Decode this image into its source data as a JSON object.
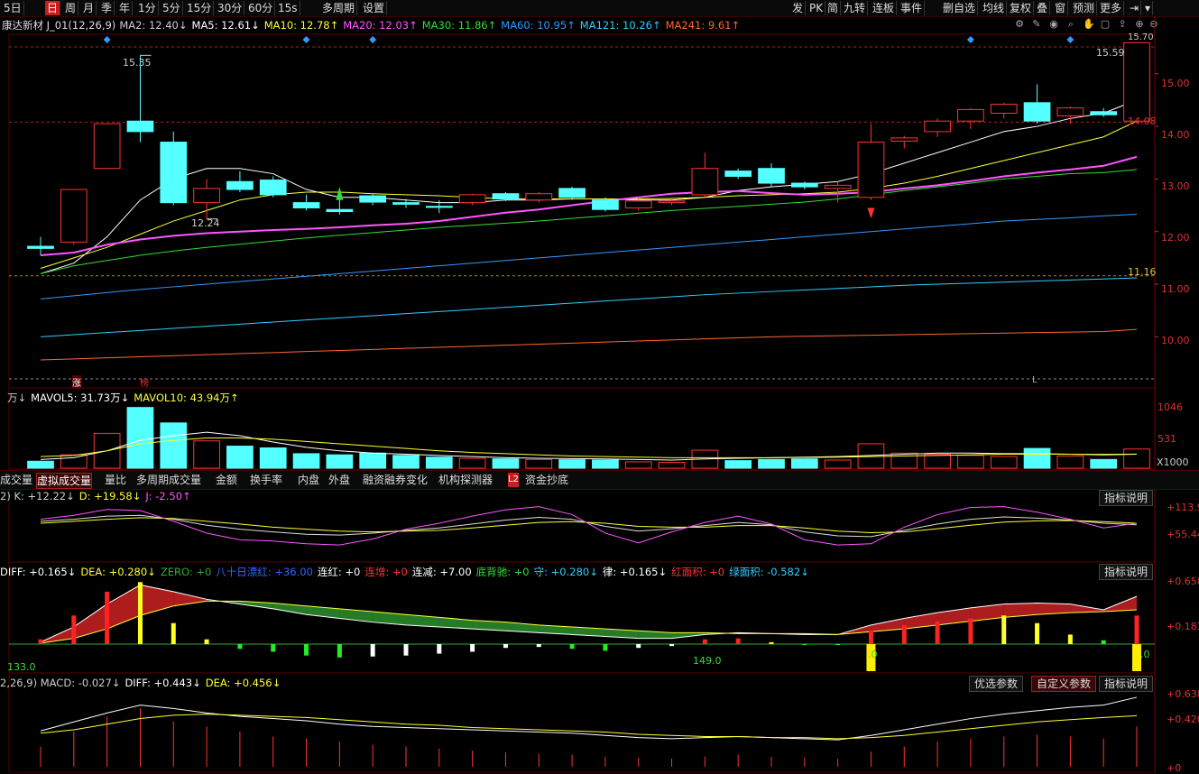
{
  "toolbar": {
    "left": [
      "5日",
      "日",
      "周",
      "月",
      "季",
      "年",
      "1分",
      "5分",
      "15分",
      "30分",
      "60分",
      "15s",
      "多周期",
      "设置"
    ],
    "active": "日",
    "right": [
      "发",
      "PK",
      "简",
      "九转",
      "连板",
      "事件",
      "删自选",
      "均线",
      "复权",
      "叠",
      "窗",
      "预测",
      "更多"
    ]
  },
  "header": {
    "name": "康达新材 J_01(12,26,9)",
    "ma": [
      {
        "label": "MA2: 12.40↓",
        "color": "#cccccc"
      },
      {
        "label": "MA5: 12.61↓",
        "color": "#ffffff"
      },
      {
        "label": "MA10: 12.78↑",
        "color": "#ffff33"
      },
      {
        "label": "MA20: 12.03↑",
        "color": "#ff55ff"
      },
      {
        "label": "MA30: 11.86↑",
        "color": "#33dd33"
      },
      {
        "label": "MA60: 10.95↑",
        "color": "#3399ff"
      },
      {
        "label": "MA121: 10.26↑",
        "color": "#33ccff"
      },
      {
        "label": "MA241: 9.61↑",
        "color": "#ff6633"
      }
    ]
  },
  "price_panel": {
    "ticks": [
      "15.00",
      "14.00",
      "13.00",
      "12.00",
      "11.00",
      "10.00"
    ],
    "labels": {
      "high": "15.35",
      "low": "12.24",
      "right_high": "15.59",
      "right_level": "14.08",
      "top_right": "15.70",
      "level2": "11.16"
    },
    "markers": [
      "涨",
      "榜",
      "L"
    ]
  },
  "volume_panel": {
    "legend": [
      {
        "label": "万↓",
        "color": "#cccccc"
      },
      {
        "label": "MAVOL5: 31.73万↓",
        "color": "#ffffff"
      },
      {
        "label": "MAVOL10: 43.94万↑",
        "color": "#ffff33"
      }
    ],
    "ticks": [
      "1046",
      "531"
    ],
    "unit": "X1000"
  },
  "tabs": {
    "items": [
      "成交量",
      "虚拟成交量",
      "量比",
      "多周期成交量",
      "金额",
      "换手率",
      "内盘",
      "外盘",
      "融资融券变化",
      "机构探测器",
      "资金抄底"
    ],
    "active": "虚拟成交量",
    "badge": "L2"
  },
  "kdj_panel": {
    "legend": [
      {
        "label": "2) K: +12.22↓",
        "color": "#cccccc"
      },
      {
        "label": "D: +19.58↓",
        "color": "#ffff33"
      },
      {
        "label": "J: -2.50↑",
        "color": "#ff55ff"
      }
    ],
    "ticks": [
      "+113.9",
      "+55.44"
    ],
    "desc_button": "指标说明"
  },
  "macd2_panel": {
    "legend": [
      {
        "label": "DIFF: +0.165↓",
        "color": "#ffffff"
      },
      {
        "label": "DEA: +0.280↓",
        "color": "#ffff33"
      },
      {
        "label": "ZERO: +0",
        "color": "#33aa33"
      },
      {
        "label": "八十日漂红: +36.00",
        "color": "#3366ff"
      },
      {
        "label": "连红: +0",
        "color": "#ffffff"
      },
      {
        "label": "连增: +0",
        "color": "#ff3333"
      },
      {
        "label": "连减: +7.00",
        "color": "#ffffff"
      },
      {
        "label": "底背驰: +0",
        "color": "#33dd33"
      },
      {
        "label": "守: +0.280↓",
        "color": "#33ccff"
      },
      {
        "label": "律: +0.165↓",
        "color": "#ffffff"
      },
      {
        "label": "红面积: +0",
        "color": "#ff3333"
      },
      {
        "label": "绿面积: -0.582↓",
        "color": "#33ccff"
      }
    ],
    "ticks": [
      "+0.658",
      "+0.183"
    ],
    "annotations": [
      "133.0",
      "149.0",
      ".0",
      ".0"
    ],
    "desc_button": "指标说明"
  },
  "macd_panel": {
    "legend": [
      {
        "label": "2,26,9) MACD: -0.027↓",
        "color": "#cccccc"
      },
      {
        "label": "DIFF: +0.443↓",
        "color": "#ffffff"
      },
      {
        "label": "DEA: +0.456↓",
        "color": "#ffff33"
      }
    ],
    "ticks": [
      "+0.638",
      "+0.420",
      "+0"
    ],
    "buttons": [
      "优选参数",
      "自定义参数",
      "指标说明"
    ],
    "active_button": "自定义参数"
  },
  "chart_data": {
    "type": "candlestick",
    "ylim": [
      9.2,
      15.75
    ],
    "candles": [
      {
        "o": 11.72,
        "h": 11.9,
        "c": 11.68,
        "l": 11.55
      },
      {
        "o": 11.8,
        "h": 12.8,
        "c": 12.8,
        "l": 11.75
      },
      {
        "o": 13.2,
        "h": 14.05,
        "c": 14.05,
        "l": 13.2
      },
      {
        "o": 14.1,
        "h": 15.35,
        "c": 13.9,
        "l": 13.7
      },
      {
        "o": 13.7,
        "h": 13.9,
        "c": 12.55,
        "l": 12.5
      },
      {
        "o": 12.55,
        "h": 13.0,
        "c": 12.82,
        "l": 12.24
      },
      {
        "o": 12.95,
        "h": 13.15,
        "c": 12.8,
        "l": 12.75
      },
      {
        "o": 12.98,
        "h": 13.05,
        "c": 12.7,
        "l": 12.65
      },
      {
        "o": 12.55,
        "h": 12.7,
        "c": 12.45,
        "l": 12.4
      },
      {
        "o": 12.42,
        "h": 12.62,
        "c": 12.38,
        "l": 12.32
      },
      {
        "o": 12.68,
        "h": 12.72,
        "c": 12.56,
        "l": 12.5
      },
      {
        "o": 12.55,
        "h": 12.62,
        "c": 12.52,
        "l": 12.45
      },
      {
        "o": 12.48,
        "h": 12.6,
        "c": 12.46,
        "l": 12.35
      },
      {
        "o": 12.55,
        "h": 12.72,
        "c": 12.7,
        "l": 12.5
      },
      {
        "o": 12.72,
        "h": 12.75,
        "c": 12.62,
        "l": 12.58
      },
      {
        "o": 12.6,
        "h": 12.75,
        "c": 12.72,
        "l": 12.55
      },
      {
        "o": 12.82,
        "h": 12.85,
        "c": 12.65,
        "l": 12.6
      },
      {
        "o": 12.6,
        "h": 12.65,
        "c": 12.42,
        "l": 12.38
      },
      {
        "o": 12.45,
        "h": 12.62,
        "c": 12.58,
        "l": 12.4
      },
      {
        "o": 12.55,
        "h": 12.62,
        "c": 12.58,
        "l": 12.5
      },
      {
        "o": 12.7,
        "h": 13.5,
        "c": 13.2,
        "l": 12.65
      },
      {
        "o": 13.15,
        "h": 13.2,
        "c": 13.05,
        "l": 13.0
      },
      {
        "o": 13.2,
        "h": 13.3,
        "c": 12.92,
        "l": 12.85
      },
      {
        "o": 12.92,
        "h": 12.95,
        "c": 12.85,
        "l": 12.8
      },
      {
        "o": 12.82,
        "h": 12.95,
        "c": 12.88,
        "l": 12.55
      },
      {
        "o": 12.65,
        "h": 14.05,
        "c": 13.7,
        "l": 12.6
      },
      {
        "o": 13.72,
        "h": 13.82,
        "c": 13.78,
        "l": 13.58
      },
      {
        "o": 13.9,
        "h": 14.15,
        "c": 14.1,
        "l": 13.8
      },
      {
        "o": 14.1,
        "h": 14.35,
        "c": 14.32,
        "l": 13.95
      },
      {
        "o": 14.25,
        "h": 14.45,
        "c": 14.42,
        "l": 14.15
      },
      {
        "o": 14.45,
        "h": 14.8,
        "c": 14.1,
        "l": 14.05
      },
      {
        "o": 14.2,
        "h": 14.38,
        "c": 14.35,
        "l": 14.05
      },
      {
        "o": 14.28,
        "h": 14.35,
        "c": 14.22,
        "l": 14.18
      },
      {
        "o": 14.1,
        "h": 15.59,
        "c": 15.59,
        "l": 14.05
      }
    ],
    "ma_series": [
      {
        "name": "MA5",
        "color": "#ffffff",
        "values": [
          11.2,
          11.4,
          11.9,
          12.6,
          13.0,
          13.2,
          13.2,
          13.1,
          12.8,
          12.65,
          12.65,
          12.6,
          12.55,
          12.55,
          12.6,
          12.6,
          12.62,
          12.62,
          12.6,
          12.6,
          12.65,
          12.78,
          12.85,
          12.9,
          12.95,
          13.1,
          13.3,
          13.5,
          13.7,
          13.9,
          14.0,
          14.15,
          14.25,
          14.5
        ]
      },
      {
        "name": "MA10",
        "color": "#ffff33",
        "values": [
          11.3,
          11.5,
          11.7,
          11.95,
          12.2,
          12.4,
          12.6,
          12.7,
          12.75,
          12.75,
          12.72,
          12.7,
          12.68,
          12.65,
          12.62,
          12.62,
          12.62,
          12.62,
          12.62,
          12.63,
          12.65,
          12.68,
          12.7,
          12.72,
          12.75,
          12.82,
          12.92,
          13.05,
          13.2,
          13.35,
          13.5,
          13.65,
          13.8,
          14.1
        ]
      },
      {
        "name": "MA20",
        "color": "#ff55ff",
        "values": [
          11.55,
          11.6,
          11.75,
          11.85,
          11.92,
          11.97,
          12.0,
          12.03,
          12.05,
          12.08,
          12.12,
          12.15,
          12.2,
          12.28,
          12.36,
          12.42,
          12.5,
          12.58,
          12.65,
          12.72,
          12.75,
          12.77,
          12.73,
          12.7,
          12.72,
          12.75,
          12.82,
          12.88,
          12.96,
          13.05,
          13.12,
          13.18,
          13.25,
          13.42
        ]
      },
      {
        "name": "MA30",
        "color": "#33dd33",
        "values": [
          11.2,
          11.35,
          11.45,
          11.55,
          11.63,
          11.7,
          11.76,
          11.82,
          11.88,
          11.93,
          11.98,
          12.03,
          12.08,
          12.12,
          12.16,
          12.2,
          12.25,
          12.3,
          12.35,
          12.4,
          12.44,
          12.48,
          12.52,
          12.56,
          12.62,
          12.7,
          12.78,
          12.85,
          12.92,
          13.0,
          13.05,
          13.1,
          13.12,
          13.18
        ]
      },
      {
        "name": "MA60",
        "color": "#3399ff",
        "values": [
          10.72,
          10.78,
          10.84,
          10.9,
          10.95,
          11.0,
          11.05,
          11.1,
          11.15,
          11.2,
          11.25,
          11.3,
          11.35,
          11.4,
          11.45,
          11.5,
          11.55,
          11.6,
          11.65,
          11.7,
          11.75,
          11.8,
          11.85,
          11.9,
          11.95,
          12.0,
          12.05,
          12.1,
          12.15,
          12.2,
          12.23,
          12.26,
          12.3,
          12.33
        ]
      },
      {
        "name": "MA121",
        "color": "#33ccff",
        "values": [
          10.0,
          10.04,
          10.08,
          10.12,
          10.16,
          10.2,
          10.24,
          10.28,
          10.32,
          10.36,
          10.4,
          10.44,
          10.48,
          10.52,
          10.56,
          10.6,
          10.64,
          10.68,
          10.72,
          10.76,
          10.8,
          10.83,
          10.86,
          10.89,
          10.92,
          10.95,
          10.98,
          11.0,
          11.02,
          11.04,
          11.06,
          11.08,
          11.1,
          11.12
        ]
      },
      {
        "name": "MA241",
        "color": "#ff6633",
        "values": [
          9.56,
          9.58,
          9.6,
          9.62,
          9.64,
          9.66,
          9.68,
          9.7,
          9.72,
          9.74,
          9.76,
          9.78,
          9.8,
          9.82,
          9.84,
          9.86,
          9.88,
          9.9,
          9.92,
          9.94,
          9.96,
          9.98,
          10.0,
          10.01,
          10.02,
          10.03,
          10.04,
          10.05,
          10.06,
          10.07,
          10.08,
          10.09,
          10.1,
          10.14
        ]
      }
    ],
    "volume": {
      "ylim": [
        0,
        1150
      ],
      "values": [
        120,
        230,
        600,
        1046,
        780,
        470,
        380,
        350,
        250,
        230,
        260,
        220,
        190,
        170,
        160,
        150,
        145,
        140,
        110,
        100,
        310,
        130,
        150,
        160,
        140,
        420,
        260,
        240,
        220,
        200,
        340,
        210,
        150,
        330
      ],
      "mavol5": [
        150,
        180,
        300,
        480,
        560,
        620,
        560,
        450,
        360,
        300,
        260,
        240,
        220,
        200,
        180,
        170,
        165,
        160,
        150,
        140,
        160,
        170,
        180,
        190,
        200,
        220,
        240,
        260,
        260,
        250,
        250,
        240,
        230,
        240
      ],
      "mavol10": [
        200,
        220,
        300,
        420,
        480,
        520,
        520,
        500,
        460,
        420,
        380,
        340,
        300,
        270,
        250,
        230,
        210,
        200,
        190,
        180,
        180,
        180,
        180,
        185,
        190,
        200,
        210,
        220,
        230,
        240,
        240,
        240,
        238,
        242
      ]
    },
    "kdj": {
      "ylim": [
        -10,
        125
      ],
      "K": [
        75,
        80,
        88,
        90,
        80,
        65,
        55,
        48,
        42,
        40,
        45,
        52,
        58,
        68,
        78,
        85,
        80,
        62,
        50,
        56,
        64,
        72,
        66,
        48,
        38,
        36,
        52,
        68,
        80,
        86,
        83,
        78,
        70,
        66
      ],
      "D": [
        70,
        75,
        80,
        84,
        82,
        75,
        68,
        60,
        55,
        50,
        48,
        50,
        52,
        58,
        65,
        72,
        74,
        70,
        62,
        60,
        60,
        64,
        64,
        58,
        50,
        46,
        48,
        56,
        65,
        73,
        76,
        77,
        74,
        70
      ],
      "J": [
        80,
        90,
        105,
        102,
        75,
        45,
        28,
        25,
        18,
        15,
        30,
        55,
        70,
        88,
        104,
        112,
        92,
        45,
        20,
        48,
        72,
        88,
        68,
        28,
        15,
        18,
        60,
        92,
        110,
        112,
        98,
        80,
        58,
        70
      ]
    },
    "macd2": {
      "ylim": [
        -0.05,
        0.7
      ],
      "DIFF": [
        0.02,
        0.18,
        0.42,
        0.62,
        0.55,
        0.47,
        0.42,
        0.37,
        0.31,
        0.27,
        0.23,
        0.2,
        0.18,
        0.16,
        0.14,
        0.12,
        0.1,
        0.08,
        0.06,
        0.06,
        0.1,
        0.12,
        0.11,
        0.1,
        0.1,
        0.2,
        0.27,
        0.33,
        0.38,
        0.42,
        0.43,
        0.42,
        0.36,
        0.5
      ],
      "DEA": [
        0.01,
        0.06,
        0.16,
        0.3,
        0.4,
        0.45,
        0.45,
        0.43,
        0.4,
        0.37,
        0.34,
        0.31,
        0.28,
        0.25,
        0.23,
        0.2,
        0.18,
        0.16,
        0.14,
        0.12,
        0.12,
        0.11,
        0.11,
        0.11,
        0.1,
        0.13,
        0.16,
        0.2,
        0.24,
        0.28,
        0.31,
        0.33,
        0.34,
        0.36
      ],
      "bars": [
        0.05,
        0.3,
        0.55,
        0.65,
        0.22,
        0.05,
        -0.05,
        -0.08,
        -0.12,
        -0.14,
        -0.13,
        -0.12,
        -0.1,
        -0.08,
        -0.04,
        -0.03,
        -0.05,
        -0.07,
        -0.04,
        -0.02,
        0.05,
        0.06,
        0.02,
        -0.01,
        0,
        0.14,
        0.2,
        0.24,
        0.27,
        0.3,
        0.22,
        0.1,
        0.04,
        0.3
      ],
      "bar_colors": [
        "r",
        "r",
        "r",
        "y",
        "y",
        "y",
        "g",
        "g",
        "g",
        "g",
        "w",
        "w",
        "w",
        "w",
        "w",
        "w",
        "g",
        "g",
        "w",
        "w",
        "r",
        "r",
        "y",
        "g",
        "g",
        "r",
        "r",
        "r",
        "r",
        "y",
        "y",
        "y",
        "g",
        "r"
      ]
    },
    "macd": {
      "ylim": [
        0,
        0.7
      ],
      "DIFF": [
        0.32,
        0.4,
        0.48,
        0.55,
        0.52,
        0.48,
        0.45,
        0.43,
        0.41,
        0.38,
        0.36,
        0.35,
        0.34,
        0.33,
        0.32,
        0.31,
        0.3,
        0.28,
        0.26,
        0.25,
        0.26,
        0.27,
        0.26,
        0.25,
        0.24,
        0.28,
        0.33,
        0.38,
        0.43,
        0.47,
        0.5,
        0.53,
        0.55,
        0.62
      ],
      "DEA": [
        0.3,
        0.33,
        0.38,
        0.43,
        0.46,
        0.47,
        0.46,
        0.45,
        0.44,
        0.42,
        0.4,
        0.38,
        0.37,
        0.35,
        0.34,
        0.33,
        0.32,
        0.31,
        0.29,
        0.28,
        0.27,
        0.27,
        0.26,
        0.26,
        0.25,
        0.26,
        0.28,
        0.31,
        0.34,
        0.37,
        0.4,
        0.42,
        0.44,
        0.456
      ],
      "bars": [
        0.2,
        0.35,
        0.5,
        0.58,
        0.45,
        0.4,
        0.35,
        0.3,
        0.28,
        0.25,
        0.22,
        0.2,
        0.18,
        0.16,
        0.14,
        0.13,
        0.12,
        0.1,
        0.09,
        0.08,
        0.1,
        0.12,
        0.1,
        0.09,
        0.08,
        0.15,
        0.2,
        0.25,
        0.28,
        0.3,
        0.32,
        0.3,
        0.28,
        0.4
      ]
    }
  }
}
